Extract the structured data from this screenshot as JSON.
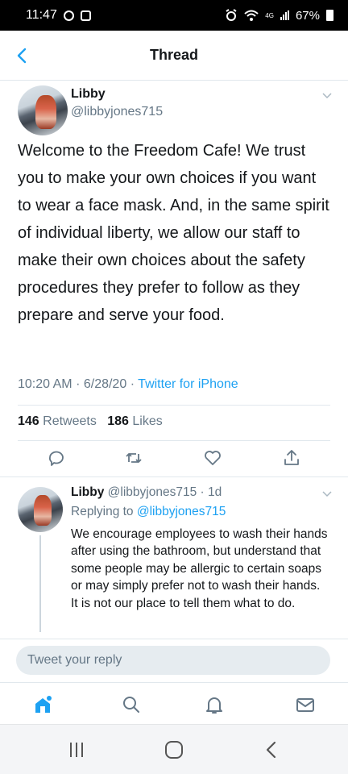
{
  "status_bar": {
    "time": "11:47",
    "battery": "67%",
    "network": "4G"
  },
  "header": {
    "title": "Thread"
  },
  "tweet": {
    "author_name": "Libby",
    "author_handle": "@libbyjones715",
    "text": "Welcome to the Freedom Cafe! We trust you to make your own choices if you want to wear a face mask. And, in the same spirit of individual liberty, we allow our staff to make their own choices about the safety procedures they prefer to follow as they prepare and serve your food.",
    "time": "10:20 AM",
    "date": "6/28/20",
    "source": "Twitter for iPhone",
    "retweets_count": "146",
    "retweets_label": "Retweets",
    "likes_count": "186",
    "likes_label": "Likes"
  },
  "reply": {
    "author_name": "Libby",
    "author_handle": "@libbyjones715",
    "age": "1d",
    "replying_prefix": "Replying to",
    "replying_to": "@libbyjones715",
    "text": "We encourage employees to wash their hands after using the bathroom, but understand that some people may be allergic to certain soaps or may simply prefer not to wash their hands. It is not our place to tell them what to do."
  },
  "composer": {
    "placeholder": "Tweet your reply"
  },
  "colors": {
    "accent": "#1da1f2",
    "secondary_text": "#657786",
    "divider": "#e1e8ed"
  }
}
